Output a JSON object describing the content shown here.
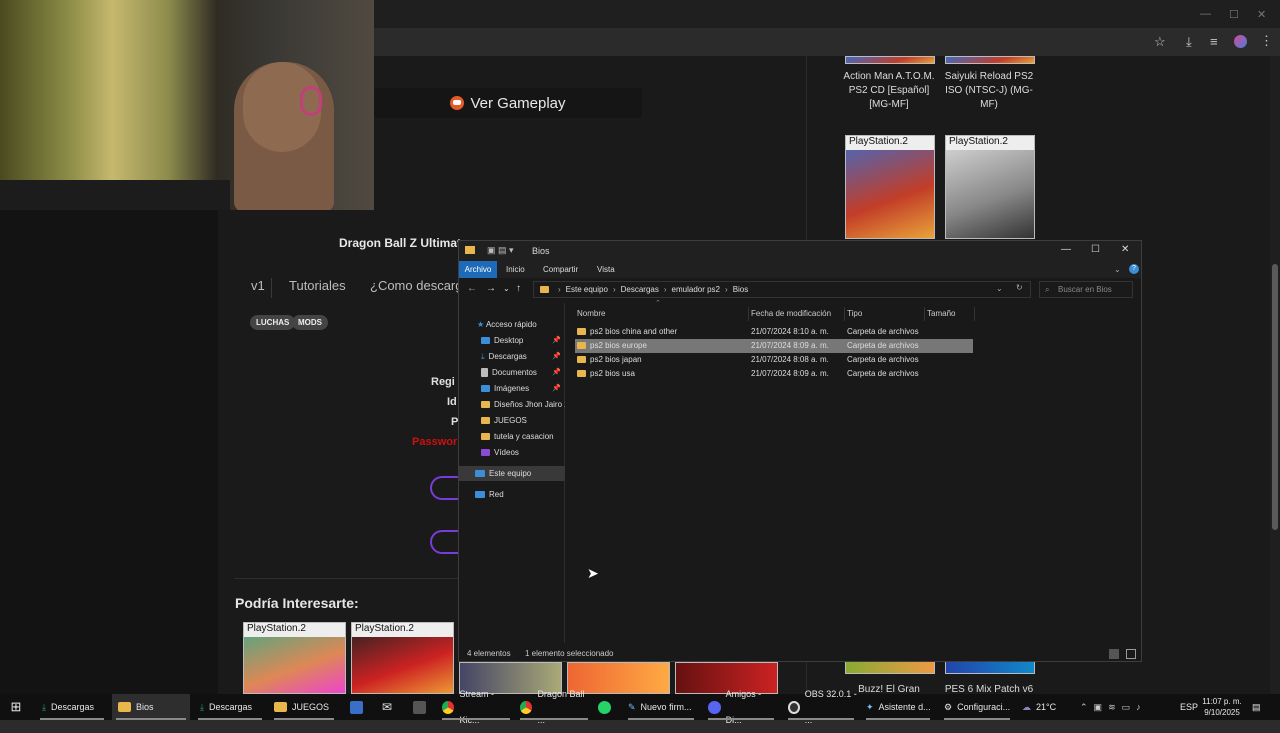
{
  "browser": {
    "window_controls": [
      "—",
      "☐",
      "✕"
    ]
  },
  "page": {
    "ver_gameplay": "Ver Gameplay",
    "game_title": "Dragon Ball Z Ultimate",
    "tabs": [
      "v1",
      "Tutoriales",
      "¿Como descarg"
    ],
    "tags": [
      "LUCHAS",
      "MODS"
    ],
    "info_labels": [
      "Regi",
      "Id",
      "P"
    ],
    "password_label": "Passwor",
    "podria_interesarte": "Podría Interesarte:",
    "right_panel_items": [
      {
        "caption": "Action Man A.T.O.M. PS2 CD [Español] [MG-MF]"
      },
      {
        "caption": "Saiyuki Reload PS2 ISO (NTSC-J) (MG-MF)"
      },
      {
        "caption": "Buzz! El Gran"
      },
      {
        "caption": "PES 6 Mix Patch v6"
      }
    ],
    "ps2_label": "PlayStation.2"
  },
  "explorer": {
    "title": "Bios",
    "window_controls": [
      "—",
      "☐",
      "✕"
    ],
    "ribbon": {
      "file": "Archivo",
      "tabs": [
        "Inicio",
        "Compartir",
        "Vista"
      ]
    },
    "path": [
      "Este equipo",
      "Descargas",
      "emulador ps2",
      "Bios"
    ],
    "search_placeholder": "Buscar en Bios",
    "sidebar": [
      {
        "label": "Acceso rápido",
        "icon": "star-icon"
      },
      {
        "label": "Desktop",
        "icon": "desktop-icon"
      },
      {
        "label": "Descargas",
        "icon": "download-icon"
      },
      {
        "label": "Documentos",
        "icon": "document-icon"
      },
      {
        "label": "Imágenes",
        "icon": "image-icon"
      },
      {
        "label": "Diseños Jhon Jairo 2",
        "icon": "folder-icon"
      },
      {
        "label": "JUEGOS",
        "icon": "folder-icon"
      },
      {
        "label": "tutela y casacion",
        "icon": "folder-icon"
      },
      {
        "label": "Vídeos",
        "icon": "video-icon"
      },
      {
        "label": "Este equipo",
        "icon": "computer-icon"
      },
      {
        "label": "Red",
        "icon": "network-icon"
      }
    ],
    "columns": [
      "Nombre",
      "Fecha de modificación",
      "Tipo",
      "Tamaño"
    ],
    "rows": [
      {
        "name": "ps2 bios china and other",
        "date": "21/07/2024 8:10 a. m.",
        "type": "Carpeta de archivos",
        "selected": false
      },
      {
        "name": "ps2 bios europe",
        "date": "21/07/2024 8:09 a. m.",
        "type": "Carpeta de archivos",
        "selected": true
      },
      {
        "name": "ps2 bios japan",
        "date": "21/07/2024 8:08 a. m.",
        "type": "Carpeta de archivos",
        "selected": false
      },
      {
        "name": "ps2 bios usa",
        "date": "21/07/2024 8:09 a. m.",
        "type": "Carpeta de archivos",
        "selected": false
      }
    ],
    "status_count": "4 elementos",
    "status_selected": "1 elemento seleccionado"
  },
  "taskbar": {
    "items": [
      {
        "label": "Descargas",
        "icon": "download-icon"
      },
      {
        "label": "Bios",
        "icon": "folder-icon"
      },
      {
        "label": "Descargas",
        "icon": "download-icon"
      },
      {
        "label": "JUEGOS",
        "icon": "folder-icon"
      },
      {
        "label": "Stream - Kic...",
        "icon": "chrome-icon"
      },
      {
        "label": "Dragon Ball ...",
        "icon": "chrome-icon"
      },
      {
        "label": "Nuevo firm...",
        "icon": "app-icon"
      },
      {
        "label": "Amigos - Di...",
        "icon": "discord-icon"
      },
      {
        "label": "OBS 32.0.1 - ...",
        "icon": "obs-icon"
      },
      {
        "label": "Asistente d...",
        "icon": "app-icon"
      },
      {
        "label": "Configuraci...",
        "icon": "gear-icon"
      }
    ],
    "weather": "21°C",
    "lang": "ESP",
    "time": "11:07 p. m.",
    "date": "9/10/2025"
  },
  "colors": {
    "accent_blue": "#1d6bb8",
    "folder_yellow": "#e8b64a",
    "password_red": "#cc1111",
    "pill_purple": "#7a3cd8"
  }
}
